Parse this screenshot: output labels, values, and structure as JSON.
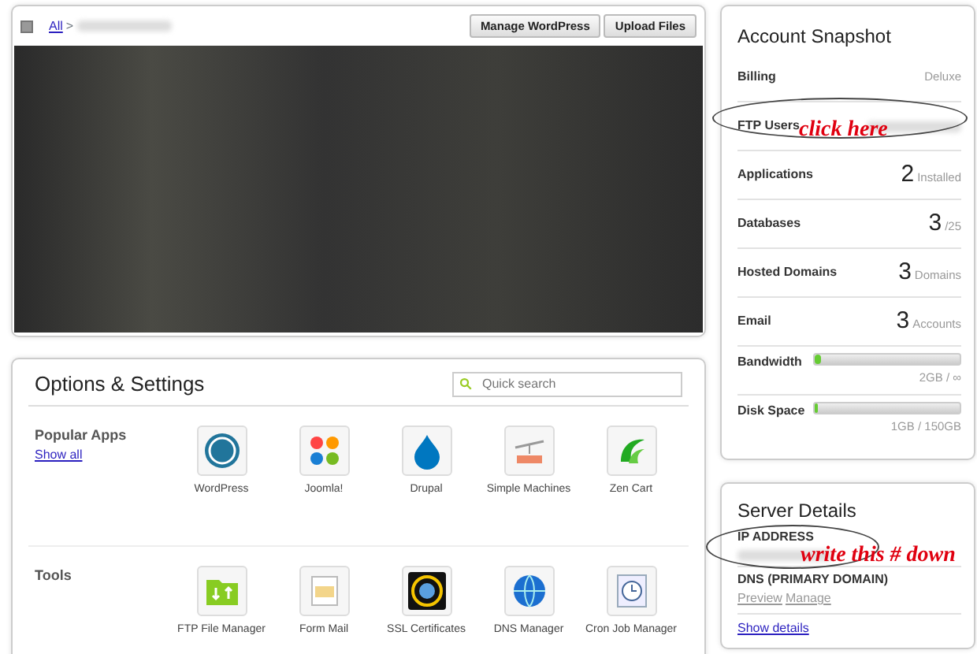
{
  "breadcrumb": {
    "link": "All",
    "separator": ">"
  },
  "header_buttons": [
    "Manage WordPress",
    "Upload Files"
  ],
  "options": {
    "title": "Options & Settings",
    "search": {
      "placeholder": "Quick search"
    },
    "sections": [
      {
        "title": "Popular Apps",
        "link": "Show all",
        "items": [
          "WordPress",
          "Joomla!",
          "Drupal",
          "Simple Machines",
          "Zen Cart"
        ]
      },
      {
        "title": "Tools",
        "items": [
          "FTP File Manager",
          "Form Mail",
          "SSL Certificates",
          "DNS Manager",
          "Cron Job Manager"
        ]
      }
    ]
  },
  "snapshot": {
    "title": "Account Snapshot",
    "rows": [
      {
        "kind": "text",
        "label": "Billing",
        "value": "Deluxe"
      },
      {
        "kind": "hidden",
        "label": "FTP Users"
      },
      {
        "kind": "count",
        "label": "Applications",
        "value": "2",
        "unit": "Installed"
      },
      {
        "kind": "count",
        "label": "Databases",
        "value": "3",
        "unit": "/25"
      },
      {
        "kind": "count",
        "label": "Hosted Domains",
        "value": "3",
        "unit": "Domains"
      },
      {
        "kind": "count",
        "label": "Email",
        "value": "3",
        "unit": "Accounts"
      },
      {
        "kind": "meter",
        "label": "Bandwidth",
        "level": 0.04,
        "reading": "2GB / ∞"
      },
      {
        "kind": "meter",
        "label": "Disk Space",
        "level": 0.02,
        "reading": "1GB / 150GB"
      }
    ]
  },
  "server": {
    "title": "Server Details",
    "fields": [
      {
        "label": "IP ADDRESS"
      },
      {
        "label": "DNS (PRIMARY DOMAIN)",
        "links": [
          "Preview",
          "Manage"
        ]
      }
    ],
    "link": "Show details"
  },
  "annotations": [
    {
      "text": "click here"
    },
    {
      "text": "write this # down"
    }
  ]
}
